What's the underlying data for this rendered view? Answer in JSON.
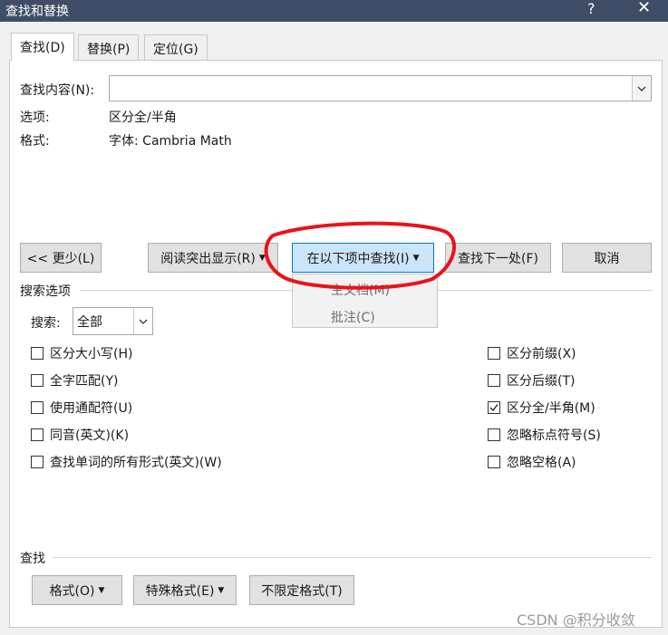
{
  "titlebar": {
    "title": "查找和替换",
    "help": "?",
    "close": "✕"
  },
  "tabs": [
    {
      "label": "查找(D)",
      "active": true
    },
    {
      "label": "替换(P)",
      "active": false
    },
    {
      "label": "定位(G)",
      "active": false
    }
  ],
  "find": {
    "label": "查找内容(N):",
    "value": "",
    "options_label": "选项:",
    "options_value": "区分全/半角",
    "format_label": "格式:",
    "format_value": "字体: Cambria Math"
  },
  "buttons": {
    "less": "<< 更少(L)",
    "reading_highlight": "阅读突出显示(R)",
    "find_in": "在以下项中查找(I)",
    "find_next": "查找下一处(F)",
    "cancel": "取消"
  },
  "dropdown": {
    "items": [
      "主文档(M)",
      "批注(C)"
    ]
  },
  "search_options": {
    "header": "搜索选项",
    "search_label": "搜索:",
    "search_value": "全部",
    "left": [
      {
        "label": "区分大小写(H)",
        "checked": false
      },
      {
        "label": "全字匹配(Y)",
        "checked": false
      },
      {
        "label": "使用通配符(U)",
        "checked": false
      },
      {
        "label": "同音(英文)(K)",
        "checked": false
      },
      {
        "label": "查找单词的所有形式(英文)(W)",
        "checked": false
      }
    ],
    "right": [
      {
        "label": "区分前缀(X)",
        "checked": false
      },
      {
        "label": "区分后缀(T)",
        "checked": false
      },
      {
        "label": "区分全/半角(M)",
        "checked": true
      },
      {
        "label": "忽略标点符号(S)",
        "checked": false
      },
      {
        "label": "忽略空格(A)",
        "checked": false
      }
    ]
  },
  "find_section": {
    "header": "查找",
    "format_btn": "格式(O)",
    "special_btn": "特殊格式(E)",
    "no_format_btn": "不限定格式(T)"
  },
  "watermark": "CSDN @积分收敛",
  "colors": {
    "titlebar": "#3f4e66",
    "highlight_btn": "#cce4f7",
    "annotation_red": "#e8131b"
  }
}
